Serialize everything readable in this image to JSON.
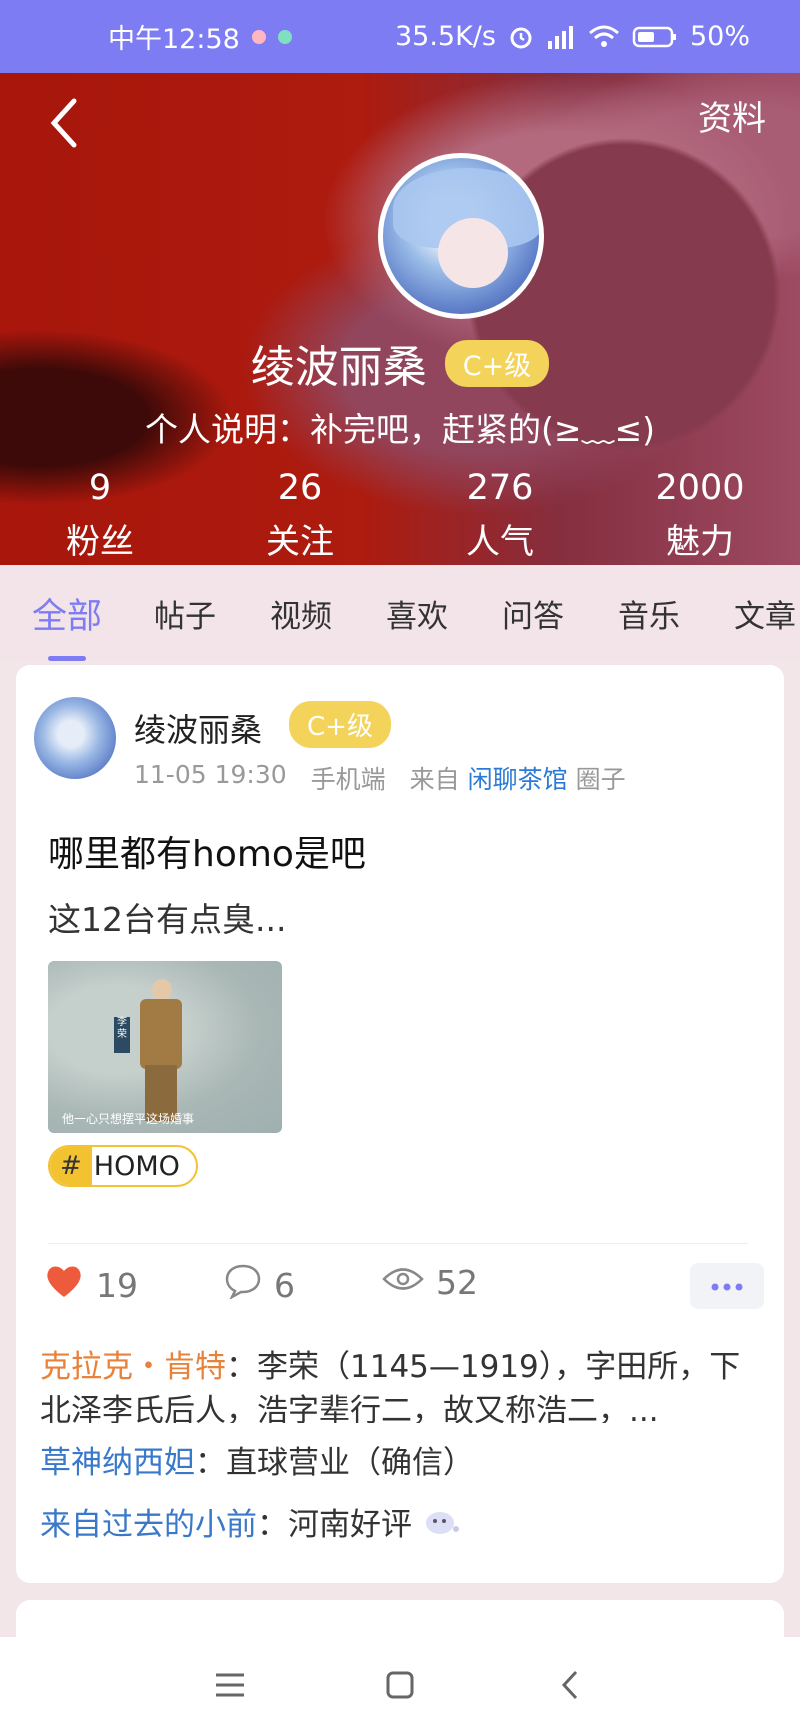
{
  "status_bar": {
    "time": "中午12:58",
    "speed": "35.5K/s",
    "battery": "50%",
    "bg_color": "#7d7cf3"
  },
  "header": {
    "back_icon": "chevron-left-icon",
    "profile_link": "资料",
    "name": "绫波丽桑",
    "level": "C+级",
    "bio": "个人说明：补完吧，赶紧的(≥﹏≤)",
    "stats": [
      {
        "num": "9",
        "label": "粉丝"
      },
      {
        "num": "26",
        "label": "关注"
      },
      {
        "num": "276",
        "label": "人气"
      },
      {
        "num": "2000",
        "label": "魅力"
      }
    ]
  },
  "tabs": [
    "全部",
    "帖子",
    "视频",
    "喜欢",
    "问答",
    "音乐",
    "文章"
  ],
  "accent_color": "#7d7cf3",
  "post": {
    "author": "绫波丽桑",
    "level": "C+级",
    "time": "11-05 19:30",
    "device": "手机端",
    "from_label": "来自",
    "circle_name": "闲聊茶馆",
    "circle_suffix": "圈子",
    "title": "哪里都有homo是吧",
    "body": "这12台有点臭...",
    "image": {
      "sign_text": "李荣",
      "caption": "他一心只想摆平这场婚事"
    },
    "tag": {
      "hash": "#",
      "name": "HOMO"
    },
    "likes": "19",
    "comments_count": "6",
    "views": "52",
    "comments": [
      {
        "user": "克拉克・肯特",
        "sep": "：",
        "text": "李荣（1145—1919），字田所，下北泽李氏后人，浩字辈行二，故又称浩二，..."
      },
      {
        "user": "草神纳西妲",
        "sep": "：",
        "text": "直球营业（确信）"
      },
      {
        "user": "来自过去的小前",
        "sep": "：",
        "text": "河南好评"
      }
    ]
  }
}
